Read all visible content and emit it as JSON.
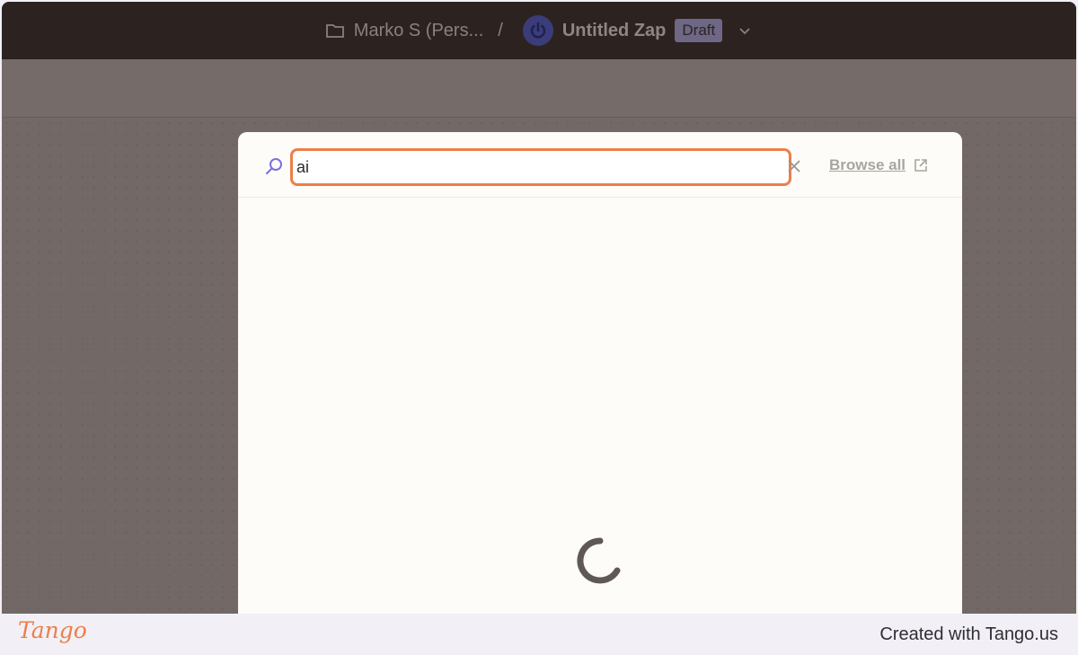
{
  "header": {
    "folder_label": "Marko S (Pers...",
    "separator": "/",
    "zap_title": "Untitled Zap",
    "status_badge": "Draft"
  },
  "search": {
    "value": "ai",
    "browse_all_label": "Browse all"
  },
  "footer": {
    "logo_text": "Tango",
    "credit": "Created with Tango.us"
  },
  "colors": {
    "accent": "#ec7f4a",
    "topbar_bg": "#2c2320",
    "overlay_bg": "#736966",
    "modal_bg": "#fdfcf8",
    "search_icon": "#7b6fe0"
  },
  "icons": {
    "folder": "folder-icon",
    "zap": "power-icon",
    "dropdown": "chevron-down-icon",
    "search": "search-icon",
    "clear": "close-icon",
    "external": "external-link-icon",
    "loading": "spinner-icon"
  }
}
